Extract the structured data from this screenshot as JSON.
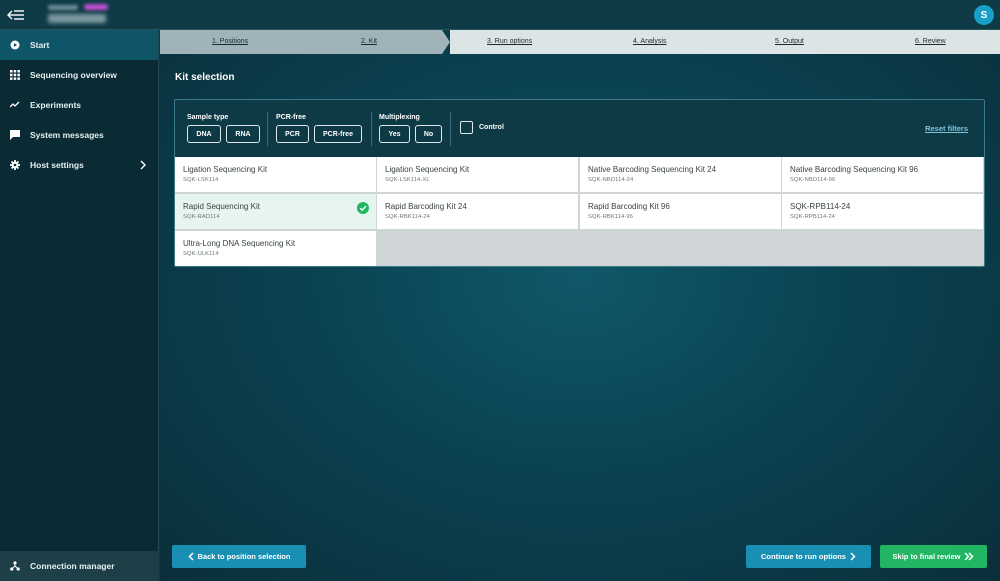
{
  "topbar": {
    "avatar_initial": "S",
    "device_name_blurred": true
  },
  "sidebar": {
    "items": [
      {
        "label": "Start",
        "icon": "play-circle-icon",
        "active": true
      },
      {
        "label": "Sequencing overview",
        "icon": "grid-icon",
        "active": false
      },
      {
        "label": "Experiments",
        "icon": "trend-icon",
        "active": false
      },
      {
        "label": "System messages",
        "icon": "message-icon",
        "active": false
      },
      {
        "label": "Host settings",
        "icon": "gear-icon",
        "active": false
      }
    ],
    "connection_manager": "Connection manager"
  },
  "stepper": {
    "steps": [
      {
        "label": "1. Positions"
      },
      {
        "label": "2. Kit"
      },
      {
        "label": "3. Run options"
      },
      {
        "label": "4. Analysis"
      },
      {
        "label": "5. Output"
      },
      {
        "label": "6. Review"
      }
    ]
  },
  "page": {
    "title": "Kit selection"
  },
  "filters": {
    "sample_type": {
      "label": "Sample type",
      "options": [
        "DNA",
        "RNA"
      ]
    },
    "pcr_free": {
      "label": "PCR-free",
      "options": [
        "PCR",
        "PCR-free"
      ]
    },
    "multiplexing": {
      "label": "Multiplexing",
      "options": [
        "Yes",
        "No"
      ]
    },
    "control_label": "Control",
    "reset_label": "Reset filters"
  },
  "kits": [
    {
      "name": "Ligation Sequencing Kit",
      "code": "SQK-LSK114",
      "selected": false
    },
    {
      "name": "Ligation Sequencing Kit",
      "code": "SQK-LSK114-XL",
      "selected": false
    },
    {
      "name": "Native Barcoding Sequencing Kit 24",
      "code": "SQK-NBD114-24",
      "selected": false
    },
    {
      "name": "Native Barcoding Sequencing Kit 96",
      "code": "SQK-NBD114-96",
      "selected": false
    },
    {
      "name": "Rapid Sequencing Kit",
      "code": "SQK-RAD114",
      "selected": true
    },
    {
      "name": "Rapid Barcoding Kit 24",
      "code": "SQK-RBK114-24",
      "selected": false
    },
    {
      "name": "Rapid Barcoding Kit 96",
      "code": "SQK-RBK114-96",
      "selected": false
    },
    {
      "name": "SQK-RPB114-24",
      "code": "SQK-RPB114-24",
      "selected": false
    },
    {
      "name": "Ultra-Long DNA Sequencing Kit",
      "code": "SQK-ULK114",
      "selected": false
    }
  ],
  "footer": {
    "back_label": "Back to position selection",
    "continue_label": "Continue to run options",
    "skip_label": "Skip to final review"
  },
  "colors": {
    "accent": "#1a8fb4",
    "success": "#21b564",
    "selected_bg": "#e6f5ee"
  }
}
